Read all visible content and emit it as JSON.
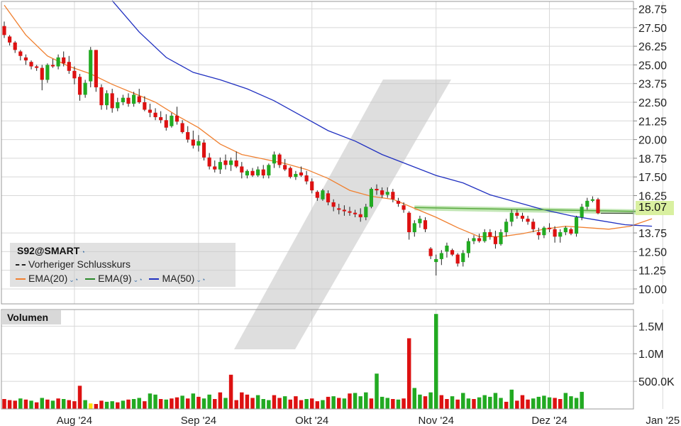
{
  "chart_data": {
    "type": "candlestick",
    "symbol_label": "S92@SMART",
    "price_axis": {
      "ticks": [
        "28.75",
        "27.50",
        "26.25",
        "25.00",
        "23.75",
        "22.50",
        "21.25",
        "20.00",
        "18.75",
        "17.50",
        "16.25",
        "13.75",
        "12.50",
        "11.25",
        "10.00"
      ],
      "range": [
        9.0,
        29.25
      ]
    },
    "volume_axis": {
      "ticks": [
        "1.5M",
        "1.0M",
        "500.0K"
      ],
      "range": [
        0,
        1800000
      ]
    },
    "date_ticks": [
      {
        "label": "Aug '24",
        "day": 13
      },
      {
        "label": "Sep '24",
        "day": 36
      },
      {
        "label": "Okt '24",
        "day": 57
      },
      {
        "label": "Nov '24",
        "day": 80
      },
      {
        "label": "Dez '24",
        "day": 101
      },
      {
        "label": "Jan '25",
        "day": 122
      }
    ],
    "last_price": "15.07",
    "legend": {
      "prev_close_label": "Vorheriger Schlusskurs",
      "items": [
        {
          "label": "EMA(20)",
          "color": "#f08030"
        },
        {
          "label": "EMA(9)",
          "color": "#2a8a2a"
        },
        {
          "label": "MA(50)",
          "color": "#2030c0"
        }
      ]
    },
    "volume_label": "Volumen",
    "colors": {
      "up": "#22aa22",
      "down": "#dd1111",
      "ema20": "#f08030",
      "ema9": "#2a8a2a",
      "ma50": "#2030c0",
      "trend": "#5aaa40"
    },
    "candles": [
      [
        27.6,
        27.9,
        26.8,
        27.0
      ],
      [
        26.9,
        27.0,
        26.3,
        26.5
      ],
      [
        26.5,
        26.6,
        25.8,
        26.0
      ],
      [
        25.9,
        26.0,
        25.3,
        25.6
      ],
      [
        25.5,
        25.7,
        25.0,
        25.3
      ],
      [
        25.2,
        25.3,
        24.7,
        24.9
      ],
      [
        24.9,
        25.0,
        24.6,
        24.8
      ],
      [
        24.8,
        25.0,
        23.3,
        24.0
      ],
      [
        24.0,
        25.1,
        23.8,
        25.0
      ],
      [
        25.0,
        25.4,
        24.8,
        24.9
      ],
      [
        24.9,
        25.7,
        24.7,
        25.5
      ],
      [
        25.5,
        25.9,
        24.9,
        25.1
      ],
      [
        25.2,
        25.6,
        24.4,
        24.6
      ],
      [
        24.6,
        24.9,
        23.7,
        24.1
      ],
      [
        24.2,
        24.4,
        22.6,
        23.0
      ],
      [
        23.0,
        24.0,
        22.8,
        23.8
      ],
      [
        23.9,
        26.2,
        23.5,
        26.0
      ],
      [
        26.0,
        26.0,
        23.2,
        23.5
      ],
      [
        23.5,
        23.7,
        22.0,
        22.3
      ],
      [
        22.3,
        23.3,
        22.0,
        23.1
      ],
      [
        23.1,
        23.4,
        21.8,
        22.1
      ],
      [
        22.1,
        22.8,
        21.9,
        22.5
      ],
      [
        22.5,
        23.0,
        22.3,
        22.8
      ],
      [
        22.8,
        23.1,
        22.2,
        22.4
      ],
      [
        22.4,
        23.2,
        22.2,
        23.0
      ],
      [
        22.9,
        23.4,
        22.4,
        22.5
      ],
      [
        22.5,
        22.9,
        21.9,
        22.0
      ],
      [
        22.0,
        22.4,
        21.5,
        21.8
      ],
      [
        21.8,
        22.1,
        21.3,
        21.5
      ],
      [
        21.5,
        21.9,
        21.1,
        21.3
      ],
      [
        21.3,
        21.7,
        20.6,
        20.8
      ],
      [
        20.9,
        21.8,
        20.8,
        21.6
      ],
      [
        21.6,
        22.2,
        21.0,
        21.2
      ],
      [
        21.1,
        21.3,
        20.4,
        20.5
      ],
      [
        20.5,
        20.9,
        19.8,
        20.0
      ],
      [
        20.0,
        20.6,
        19.4,
        19.6
      ],
      [
        19.6,
        20.3,
        19.2,
        19.9
      ],
      [
        19.8,
        20.0,
        18.6,
        18.8
      ],
      [
        18.8,
        19.1,
        18.0,
        18.2
      ],
      [
        18.2,
        18.6,
        17.8,
        18.0
      ],
      [
        18.0,
        18.8,
        17.7,
        18.5
      ],
      [
        18.6,
        19.0,
        18.0,
        18.3
      ],
      [
        18.3,
        18.8,
        17.9,
        18.6
      ],
      [
        18.6,
        19.2,
        18.1,
        18.2
      ],
      [
        18.2,
        18.5,
        17.4,
        17.8
      ],
      [
        17.6,
        18.0,
        17.4,
        17.9
      ],
      [
        17.9,
        18.1,
        17.5,
        17.6
      ],
      [
        17.6,
        18.2,
        17.5,
        18.0
      ],
      [
        18.0,
        18.3,
        17.4,
        17.6
      ],
      [
        17.6,
        18.4,
        17.4,
        18.3
      ],
      [
        18.4,
        19.2,
        18.1,
        19.0
      ],
      [
        19.0,
        19.1,
        18.1,
        18.3
      ],
      [
        18.3,
        18.7,
        17.9,
        18.0
      ],
      [
        18.1,
        18.2,
        17.4,
        17.5
      ],
      [
        17.5,
        17.9,
        17.3,
        17.7
      ],
      [
        17.8,
        18.2,
        17.5,
        17.6
      ],
      [
        17.6,
        17.9,
        17.0,
        17.2
      ],
      [
        17.2,
        17.4,
        16.4,
        16.6
      ],
      [
        16.5,
        16.6,
        15.9,
        16.1
      ],
      [
        16.0,
        16.7,
        15.9,
        16.6
      ],
      [
        16.4,
        16.6,
        15.6,
        15.8
      ],
      [
        15.8,
        16.0,
        15.2,
        15.5
      ],
      [
        15.4,
        15.7,
        15.0,
        15.3
      ],
      [
        15.3,
        15.6,
        14.9,
        15.2
      ],
      [
        15.2,
        15.5,
        14.9,
        15.1
      ],
      [
        15.1,
        15.3,
        14.8,
        15.0
      ],
      [
        15.0,
        15.4,
        14.5,
        14.8
      ],
      [
        14.8,
        15.7,
        14.6,
        15.5
      ],
      [
        15.5,
        16.8,
        15.4,
        16.7
      ],
      [
        16.7,
        17.0,
        16.3,
        16.6
      ],
      [
        16.6,
        16.8,
        16.1,
        16.3
      ],
      [
        16.3,
        16.8,
        16.1,
        16.5
      ],
      [
        16.5,
        16.7,
        15.8,
        16.0
      ],
      [
        15.9,
        16.1,
        15.5,
        15.7
      ],
      [
        15.6,
        15.8,
        15.1,
        15.3
      ],
      [
        15.1,
        15.2,
        13.3,
        13.8
      ],
      [
        13.8,
        14.6,
        13.5,
        14.4
      ],
      [
        14.4,
        14.9,
        14.1,
        14.7
      ],
      [
        14.6,
        14.8,
        13.8,
        14.0
      ],
      [
        12.7,
        12.8,
        12.0,
        12.2
      ],
      [
        11.8,
        12.3,
        10.9,
        12.0
      ],
      [
        12.0,
        12.6,
        11.6,
        12.4
      ],
      [
        12.5,
        13.1,
        12.1,
        12.9
      ],
      [
        12.6,
        12.7,
        12.2,
        12.3
      ],
      [
        12.3,
        12.4,
        11.5,
        11.7
      ],
      [
        11.8,
        12.6,
        11.5,
        12.4
      ],
      [
        12.4,
        13.4,
        12.1,
        13.2
      ],
      [
        13.2,
        13.6,
        13.0,
        13.4
      ],
      [
        13.4,
        13.7,
        13.1,
        13.2
      ],
      [
        13.2,
        14.0,
        13.1,
        13.8
      ],
      [
        13.8,
        14.0,
        13.3,
        13.5
      ],
      [
        13.5,
        13.9,
        12.7,
        13.0
      ],
      [
        13.0,
        14.0,
        12.9,
        13.8
      ],
      [
        13.8,
        14.7,
        13.5,
        14.5
      ],
      [
        14.5,
        15.3,
        14.2,
        15.1
      ],
      [
        15.1,
        15.3,
        14.7,
        14.9
      ],
      [
        14.9,
        15.1,
        14.5,
        14.7
      ],
      [
        14.7,
        14.9,
        14.3,
        14.5
      ],
      [
        14.5,
        14.7,
        13.8,
        14.0
      ],
      [
        13.8,
        14.1,
        13.3,
        13.6
      ],
      [
        13.6,
        14.2,
        13.4,
        14.1
      ],
      [
        14.1,
        14.4,
        13.8,
        14.0
      ],
      [
        14.0,
        14.2,
        13.1,
        13.5
      ],
      [
        13.5,
        14.0,
        13.1,
        13.8
      ],
      [
        13.8,
        14.2,
        13.6,
        14.1
      ],
      [
        14.0,
        14.1,
        13.6,
        13.7
      ],
      [
        13.7,
        14.9,
        13.5,
        14.8
      ],
      [
        14.8,
        15.7,
        14.6,
        15.5
      ],
      [
        15.5,
        16.1,
        15.3,
        15.9
      ],
      [
        15.9,
        16.2,
        15.8,
        16.0
      ],
      [
        16.0,
        16.1,
        15.0,
        15.07
      ]
    ],
    "volumes": [
      [
        180000,
        "down"
      ],
      [
        160000,
        "down"
      ],
      [
        150000,
        "down"
      ],
      [
        190000,
        "up"
      ],
      [
        170000,
        "down"
      ],
      [
        150000,
        "up"
      ],
      [
        120000,
        "down"
      ],
      [
        200000,
        "up"
      ],
      [
        170000,
        "down"
      ],
      [
        150000,
        "up"
      ],
      [
        190000,
        "down"
      ],
      [
        180000,
        "up"
      ],
      [
        160000,
        "down"
      ],
      [
        140000,
        "down"
      ],
      [
        420000,
        "down"
      ],
      [
        160000,
        "up"
      ],
      [
        100000,
        "yellow"
      ],
      [
        90000,
        "down"
      ],
      [
        150000,
        "down"
      ],
      [
        130000,
        "up"
      ],
      [
        140000,
        "up"
      ],
      [
        120000,
        "down"
      ],
      [
        150000,
        "up"
      ],
      [
        170000,
        "down"
      ],
      [
        180000,
        "up"
      ],
      [
        200000,
        "up"
      ],
      [
        140000,
        "down"
      ],
      [
        280000,
        "up"
      ],
      [
        260000,
        "up"
      ],
      [
        180000,
        "down"
      ],
      [
        170000,
        "up"
      ],
      [
        190000,
        "down"
      ],
      [
        210000,
        "down"
      ],
      [
        240000,
        "up"
      ],
      [
        190000,
        "down"
      ],
      [
        280000,
        "up"
      ],
      [
        220000,
        "down"
      ],
      [
        190000,
        "up"
      ],
      [
        260000,
        "up"
      ],
      [
        180000,
        "down"
      ],
      [
        300000,
        "down"
      ],
      [
        200000,
        "up"
      ],
      [
        620000,
        "down"
      ],
      [
        160000,
        "down"
      ],
      [
        300000,
        "down"
      ],
      [
        260000,
        "down"
      ],
      [
        200000,
        "down"
      ],
      [
        250000,
        "up"
      ],
      [
        180000,
        "up"
      ],
      [
        160000,
        "up"
      ],
      [
        250000,
        "down"
      ],
      [
        200000,
        "down"
      ],
      [
        230000,
        "up"
      ],
      [
        170000,
        "down"
      ],
      [
        230000,
        "down"
      ],
      [
        160000,
        "down"
      ],
      [
        180000,
        "up"
      ],
      [
        190000,
        "down"
      ],
      [
        140000,
        "down"
      ],
      [
        160000,
        "up"
      ],
      [
        220000,
        "down"
      ],
      [
        230000,
        "up"
      ],
      [
        200000,
        "down"
      ],
      [
        190000,
        "up"
      ],
      [
        280000,
        "down"
      ],
      [
        290000,
        "up"
      ],
      [
        230000,
        "up"
      ],
      [
        300000,
        "up"
      ],
      [
        190000,
        "down"
      ],
      [
        640000,
        "up"
      ],
      [
        220000,
        "up"
      ],
      [
        200000,
        "up"
      ],
      [
        180000,
        "down"
      ],
      [
        170000,
        "up"
      ],
      [
        190000,
        "down"
      ],
      [
        1280000,
        "down"
      ],
      [
        380000,
        "up"
      ],
      [
        260000,
        "up"
      ],
      [
        230000,
        "down"
      ],
      [
        300000,
        "up"
      ],
      [
        1720000,
        "up"
      ],
      [
        250000,
        "down"
      ],
      [
        180000,
        "down"
      ],
      [
        230000,
        "up"
      ],
      [
        170000,
        "down"
      ],
      [
        290000,
        "up"
      ],
      [
        190000,
        "up"
      ],
      [
        180000,
        "down"
      ],
      [
        210000,
        "up"
      ],
      [
        250000,
        "up"
      ],
      [
        220000,
        "up"
      ],
      [
        290000,
        "up"
      ],
      [
        200000,
        "up"
      ],
      [
        130000,
        "down"
      ],
      [
        350000,
        "up"
      ],
      [
        150000,
        "down"
      ],
      [
        250000,
        "down"
      ],
      [
        170000,
        "down"
      ],
      [
        190000,
        "up"
      ],
      [
        220000,
        "up"
      ],
      [
        240000,
        "up"
      ],
      [
        210000,
        "up"
      ],
      [
        200000,
        "down"
      ],
      [
        180000,
        "down"
      ],
      [
        290000,
        "up"
      ],
      [
        230000,
        "up"
      ],
      [
        200000,
        "up"
      ],
      [
        310000,
        "up"
      ]
    ],
    "ema20": [
      [
        0,
        29.0
      ],
      [
        4,
        27.0
      ],
      [
        8,
        25.6
      ],
      [
        12,
        24.9
      ],
      [
        16,
        24.4
      ],
      [
        20,
        23.7
      ],
      [
        24,
        23.1
      ],
      [
        28,
        22.5
      ],
      [
        32,
        21.6
      ],
      [
        36,
        20.8
      ],
      [
        40,
        19.7
      ],
      [
        44,
        19.0
      ],
      [
        48,
        18.7
      ],
      [
        52,
        18.4
      ],
      [
        56,
        18.0
      ],
      [
        60,
        17.4
      ],
      [
        64,
        16.6
      ],
      [
        68,
        16.2
      ],
      [
        72,
        16.0
      ],
      [
        76,
        15.4
      ],
      [
        80,
        14.8
      ],
      [
        84,
        14.1
      ],
      [
        88,
        13.5
      ],
      [
        92,
        13.5
      ],
      [
        96,
        13.7
      ],
      [
        100,
        14.0
      ],
      [
        104,
        14.2
      ],
      [
        108,
        14.1
      ],
      [
        112,
        14.0
      ],
      [
        116,
        14.2
      ],
      [
        120,
        14.7
      ]
    ],
    "ma50": [
      [
        20,
        29.3
      ],
      [
        25,
        27.2
      ],
      [
        30,
        25.5
      ],
      [
        35,
        24.5
      ],
      [
        40,
        24.0
      ],
      [
        45,
        23.4
      ],
      [
        50,
        22.6
      ],
      [
        55,
        21.6
      ],
      [
        60,
        20.6
      ],
      [
        65,
        19.9
      ],
      [
        70,
        19.0
      ],
      [
        75,
        18.3
      ],
      [
        80,
        17.6
      ],
      [
        85,
        17.1
      ],
      [
        90,
        16.3
      ],
      [
        95,
        15.8
      ],
      [
        100,
        15.3
      ],
      [
        105,
        14.9
      ],
      [
        110,
        14.6
      ],
      [
        115,
        14.3
      ],
      [
        120,
        14.2
      ]
    ],
    "trend": [
      [
        76,
        15.45
      ],
      [
        123,
        15.15
      ]
    ]
  }
}
